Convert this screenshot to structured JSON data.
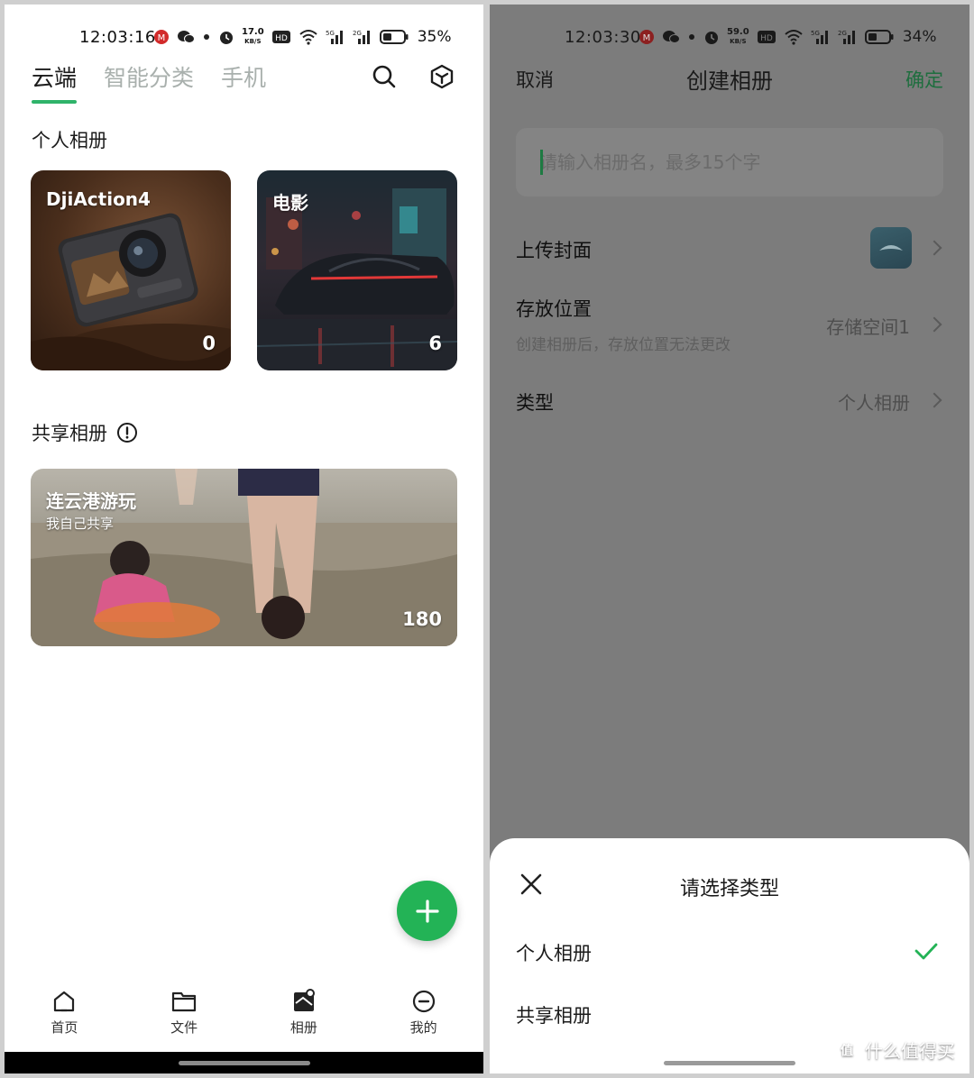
{
  "left": {
    "status": {
      "time": "12:03:16",
      "speed_value": "17.0",
      "speed_unit": "KB/S",
      "battery": "35%"
    },
    "tabs": [
      {
        "label": "云端",
        "active": true
      },
      {
        "label": "智能分类",
        "active": false
      },
      {
        "label": "手机",
        "active": false
      }
    ],
    "personal_section": "个人相册",
    "personal_albums": [
      {
        "title": "DjiAction4",
        "count": "0"
      },
      {
        "title": "电影",
        "count": "6"
      }
    ],
    "shared_section": "共享相册",
    "shared_album": {
      "title": "连云港游玩",
      "subtitle": "我自己共享",
      "count": "180"
    },
    "nav": [
      {
        "label": "首页",
        "icon": "home-icon"
      },
      {
        "label": "文件",
        "icon": "folder-icon"
      },
      {
        "label": "相册",
        "icon": "album-icon"
      },
      {
        "label": "我的",
        "icon": "profile-icon"
      }
    ],
    "accent": "#23b356"
  },
  "right": {
    "status": {
      "time": "12:03:30",
      "speed_value": "59.0",
      "speed_unit": "KB/S",
      "battery": "34%"
    },
    "header": {
      "cancel": "取消",
      "title": "创建相册",
      "confirm": "确定"
    },
    "name_input": {
      "placeholder": "请输入相册名，最多15个字"
    },
    "rows": {
      "cover": {
        "label": "上传封面"
      },
      "location": {
        "label": "存放位置",
        "value": "存储空间1",
        "hint": "创建相册后，存放位置无法更改"
      },
      "type": {
        "label": "类型",
        "value": "个人相册"
      }
    },
    "sheet": {
      "title": "请选择类型",
      "options": [
        {
          "label": "个人相册",
          "selected": true
        },
        {
          "label": "共享相册",
          "selected": false
        }
      ]
    },
    "watermark": {
      "badge": "值",
      "text": "什么值得买"
    }
  }
}
